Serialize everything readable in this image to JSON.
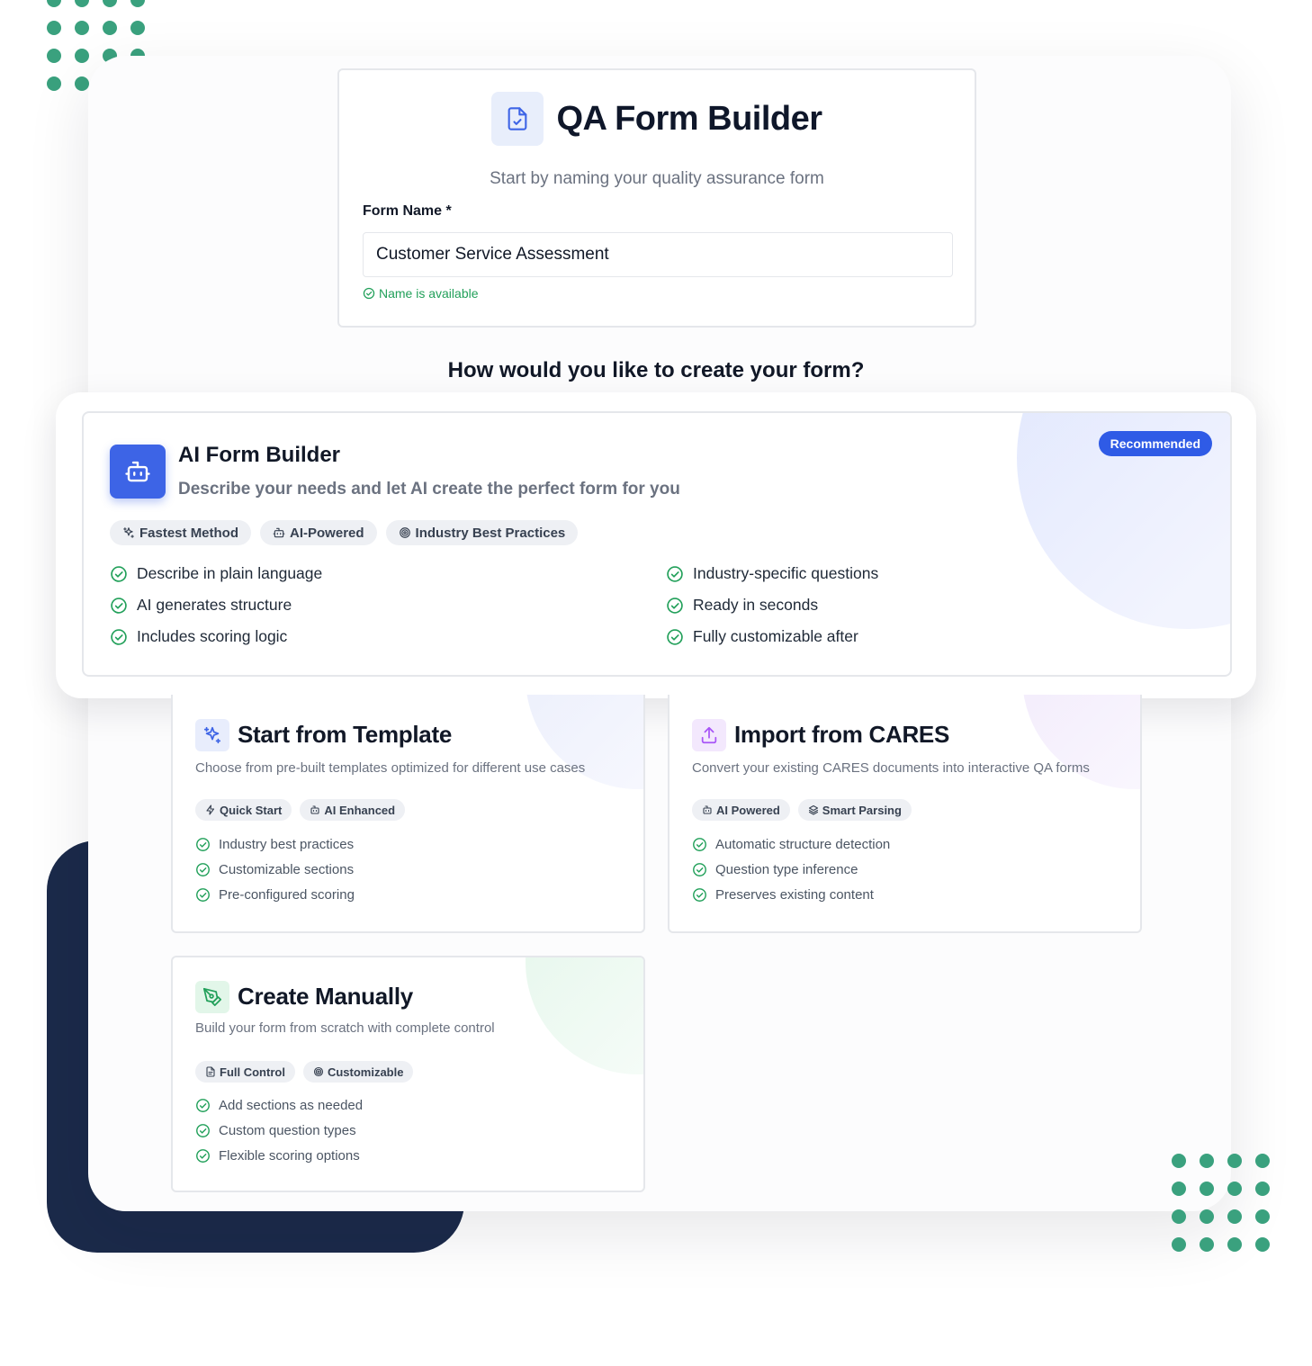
{
  "header": {
    "title": "QA Form Builder",
    "subtitle": "Start by naming your quality assurance form",
    "form_name_label": "Form Name *",
    "form_name_value": "Customer Service Assessment",
    "availability": "Name is available"
  },
  "question": "How would you like to create your form?",
  "ai_builder": {
    "badge": "Recommended",
    "title": "AI Form Builder",
    "description": "Describe your needs and let AI create the perfect form for you",
    "tags": [
      "Fastest Method",
      "AI-Powered",
      "Industry Best Practices"
    ],
    "features": [
      "Describe in plain language",
      "Industry-specific questions",
      "AI generates structure",
      "Ready in seconds",
      "Includes scoring logic",
      "Fully customizable after"
    ]
  },
  "template": {
    "title": "Start from Template",
    "description": "Choose from pre-built templates optimized for different use cases",
    "tags": [
      "Quick Start",
      "AI Enhanced"
    ],
    "features": [
      "Industry best practices",
      "Customizable sections",
      "Pre-configured scoring"
    ]
  },
  "import": {
    "title": "Import from CARES",
    "description": "Convert your existing CARES documents into interactive QA forms",
    "tags": [
      "AI Powered",
      "Smart Parsing"
    ],
    "features": [
      "Automatic structure detection",
      "Question type inference",
      "Preserves existing content"
    ]
  },
  "manual": {
    "title": "Create Manually",
    "description": "Build your form from scratch with complete control",
    "tags": [
      "Full Control",
      "Customizable"
    ],
    "features": [
      "Add sections as needed",
      "Custom question types",
      "Flexible scoring options"
    ]
  },
  "icons": {
    "header": "file-check-icon",
    "ai": "robot-icon",
    "template": "sparkles-icon",
    "import": "upload-icon",
    "manual": "pen-tool-icon",
    "check": "check-circle-icon"
  },
  "colors": {
    "accent": "#2f5be6",
    "success": "#22a05a",
    "navy": "#1b2a4a",
    "dots": "#3aa17e"
  }
}
